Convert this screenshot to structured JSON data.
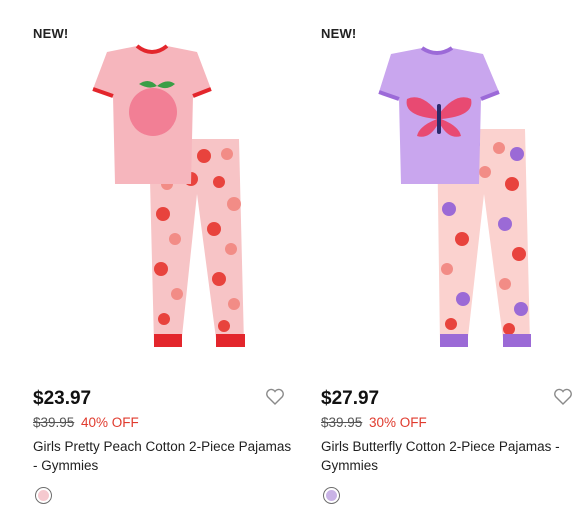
{
  "products": [
    {
      "badge": "NEW!",
      "price": "$23.97",
      "was_price": "$39.95",
      "discount": "40% OFF",
      "title": "Girls Pretty Peach Cotton 2-Piece Pajamas - Gymmies",
      "swatch_color": "#f5c9cf",
      "image_icon": "peach-pajamas-image"
    },
    {
      "badge": "NEW!",
      "price": "$27.97",
      "was_price": "$39.95",
      "discount": "30% OFF",
      "title": "Girls Butterfly Cotton 2-Piece Pajamas - Gymmies",
      "swatch_color": "#c9b3e6",
      "image_icon": "butterfly-pajamas-image"
    }
  ],
  "colors": {
    "discount": "#e03b2e",
    "price": "#111111"
  },
  "icons": {
    "favorite": "heart-outline-icon"
  }
}
